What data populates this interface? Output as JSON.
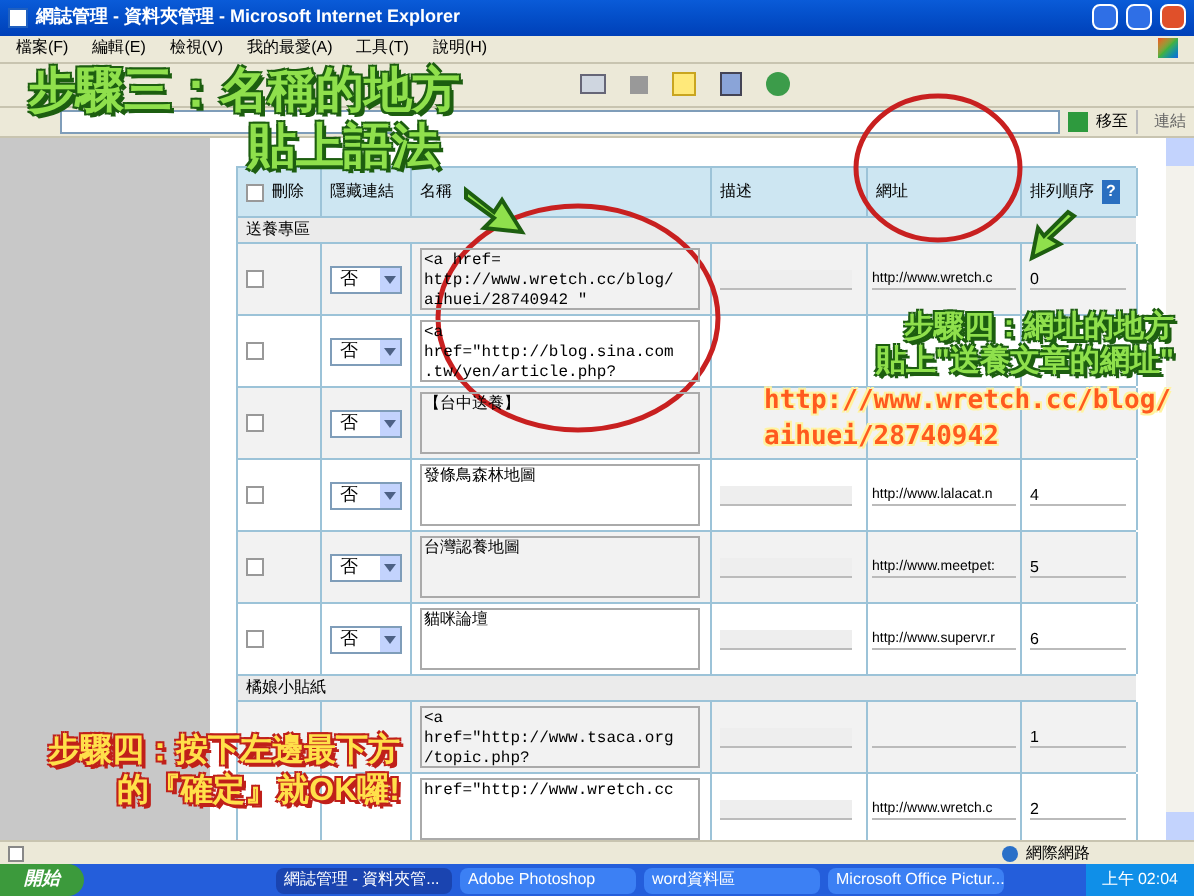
{
  "window": {
    "title": "網誌管理 - 資料夾管理 - Microsoft Internet Explorer"
  },
  "menu": [
    "檔案(F)",
    "編輯(E)",
    "檢視(V)",
    "我的最愛(A)",
    "工具(T)",
    "說明(H)"
  ],
  "address": {
    "go": "移至",
    "links": "連結"
  },
  "table": {
    "columns": [
      {
        "label": "刪除",
        "checked": false
      },
      {
        "label": "隱藏連結"
      },
      {
        "label": "名稱"
      },
      {
        "label": "描述"
      },
      {
        "label": "網址"
      },
      {
        "label": "排列順序",
        "help": "?"
      }
    ],
    "sections": [
      {
        "title": "送養專區",
        "rows": [
          {
            "checked": false,
            "hidden": "否",
            "name": "<a href=\nhttp://www.wretch.cc/blog/\naihuei/28740942 \"",
            "covered": false,
            "url": "http://www.wretch.c",
            "order": "0"
          },
          {
            "checked": false,
            "hidden": "否",
            "name": "<a\nhref=\"http://blog.sina.com\n.tw/yen/article.php?",
            "covered": true
          },
          {
            "checked": false,
            "hidden": "否",
            "name": "【台中送養】",
            "covered": true
          },
          {
            "checked": false,
            "hidden": "否",
            "name": "發條鳥森林地圖",
            "covered": false,
            "url": "http://www.lalacat.n",
            "order": "4"
          },
          {
            "checked": false,
            "hidden": "否",
            "name": "台灣認養地圖",
            "covered": false,
            "url": "http://www.meetpet:",
            "order": "5"
          },
          {
            "checked": false,
            "hidden": "否",
            "name": "貓咪論壇",
            "covered": false,
            "url": "http://www.supervr.r",
            "order": "6"
          }
        ]
      },
      {
        "title": "橘娘小貼紙",
        "rows": [
          {
            "name": "<a\nhref=\"http://www.tsaca.org\n/topic.php?",
            "covered": false,
            "url": "",
            "order": "1"
          },
          {
            "name": "href=\"http://www.wretch.cc",
            "covered": false,
            "url": "http://www.wretch.c",
            "order": "2"
          }
        ]
      }
    ]
  },
  "annotations": {
    "step3": [
      "步驟三：名稱的地方",
      "貼上語法"
    ],
    "step4_url": [
      "步驟四：網址的地方",
      "貼上\"送養文章的網址\""
    ],
    "url_note": [
      "http://www.wretch.cc/blog/",
      "aihuei/28740942"
    ],
    "step4_confirm": [
      "步驟四：按下左邊最下方",
      "的『確定』就OK囉!"
    ]
  },
  "status_bar": {
    "zone": "網際網路"
  },
  "taskbar": {
    "start": "開始",
    "tasks": [
      {
        "label": "網誌管理 - 資料夾管...",
        "selected": true
      },
      {
        "label": "Adobe Photoshop",
        "selected": false
      },
      {
        "label": "word資料區",
        "selected": false
      },
      {
        "label": "Microsoft Office Pictur...",
        "selected": false
      }
    ],
    "clock": "上午 02:04"
  }
}
